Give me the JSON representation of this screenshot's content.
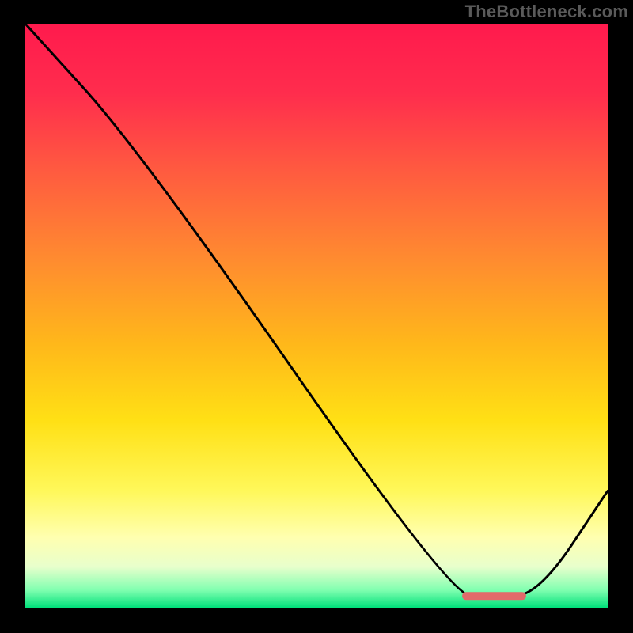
{
  "watermark": "TheBottleneck.com",
  "chart_data": {
    "type": "line",
    "title": "",
    "xlabel": "",
    "ylabel": "",
    "xlim": [
      0,
      100
    ],
    "ylim": [
      0,
      100
    ],
    "x": [
      0,
      20,
      73,
      80,
      88,
      100
    ],
    "values": [
      100,
      78,
      2,
      2,
      2,
      20
    ],
    "marker": {
      "x_start": 75,
      "x_end": 86,
      "y": 2,
      "color": "#e26a6a"
    },
    "gradient_stops": [
      {
        "offset": 0.0,
        "color": "#ff1a4d"
      },
      {
        "offset": 0.12,
        "color": "#ff2d4d"
      },
      {
        "offset": 0.25,
        "color": "#ff5a40"
      },
      {
        "offset": 0.4,
        "color": "#ff8a30"
      },
      {
        "offset": 0.55,
        "color": "#ffb81a"
      },
      {
        "offset": 0.68,
        "color": "#ffe015"
      },
      {
        "offset": 0.8,
        "color": "#fff85a"
      },
      {
        "offset": 0.88,
        "color": "#ffffb0"
      },
      {
        "offset": 0.93,
        "color": "#e8ffcc"
      },
      {
        "offset": 0.97,
        "color": "#80ffb0"
      },
      {
        "offset": 1.0,
        "color": "#00e07a"
      }
    ]
  }
}
